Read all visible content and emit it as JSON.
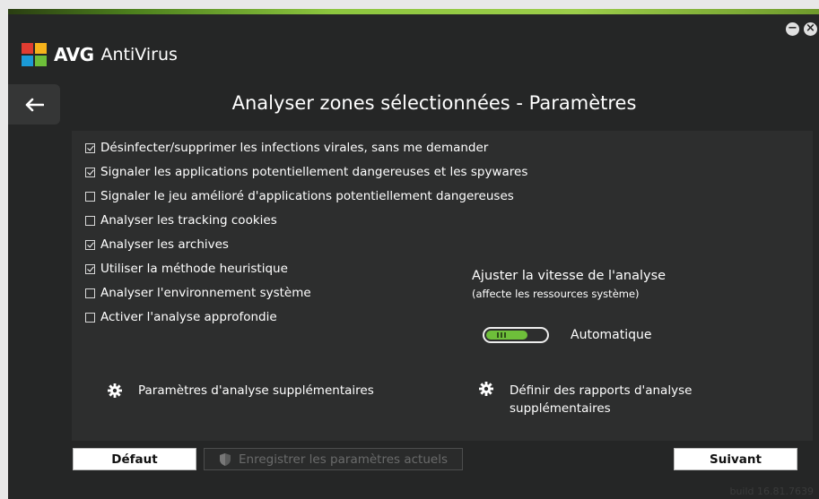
{
  "app": {
    "brand": "AVG",
    "product": "AntiVirus"
  },
  "window_controls": {
    "minimize": "−",
    "close": "×"
  },
  "page": {
    "title": "Analyser zones sélectionnées - Paramètres"
  },
  "options": [
    {
      "label": "Désinfecter/supprimer les infections virales, sans me demander",
      "checked": true
    },
    {
      "label": "Signaler les applications potentiellement dangereuses et les spywares",
      "checked": true
    },
    {
      "label": "Signaler le jeu amélioré d'applications potentiellement dangereuses",
      "checked": false
    },
    {
      "label": "Analyser les tracking cookies",
      "checked": false
    },
    {
      "label": "Analyser les archives",
      "checked": true
    },
    {
      "label": "Utiliser la méthode heuristique",
      "checked": true
    },
    {
      "label": "Analyser l'environnement système",
      "checked": false
    },
    {
      "label": "Activer l'analyse approfondie",
      "checked": false
    }
  ],
  "speed": {
    "title": "Ajuster la vitesse de l'analyse",
    "subtitle": "(affecte les ressources système)",
    "value_label": "Automatique",
    "level": 0.7
  },
  "links": {
    "extra_params": "Paramètres d'analyse supplémentaires",
    "reports_line1": "Définir des rapports d'analyse",
    "reports_line2": "supplémentaires"
  },
  "buttons": {
    "default": "Défaut",
    "save": "Enregistrer les paramètres actuels",
    "next": "Suivant"
  },
  "build": "build 16.81.7639",
  "colors": {
    "accent_green": "#6ebf3a",
    "background": "#252626",
    "panel": "#2d2e2e"
  }
}
